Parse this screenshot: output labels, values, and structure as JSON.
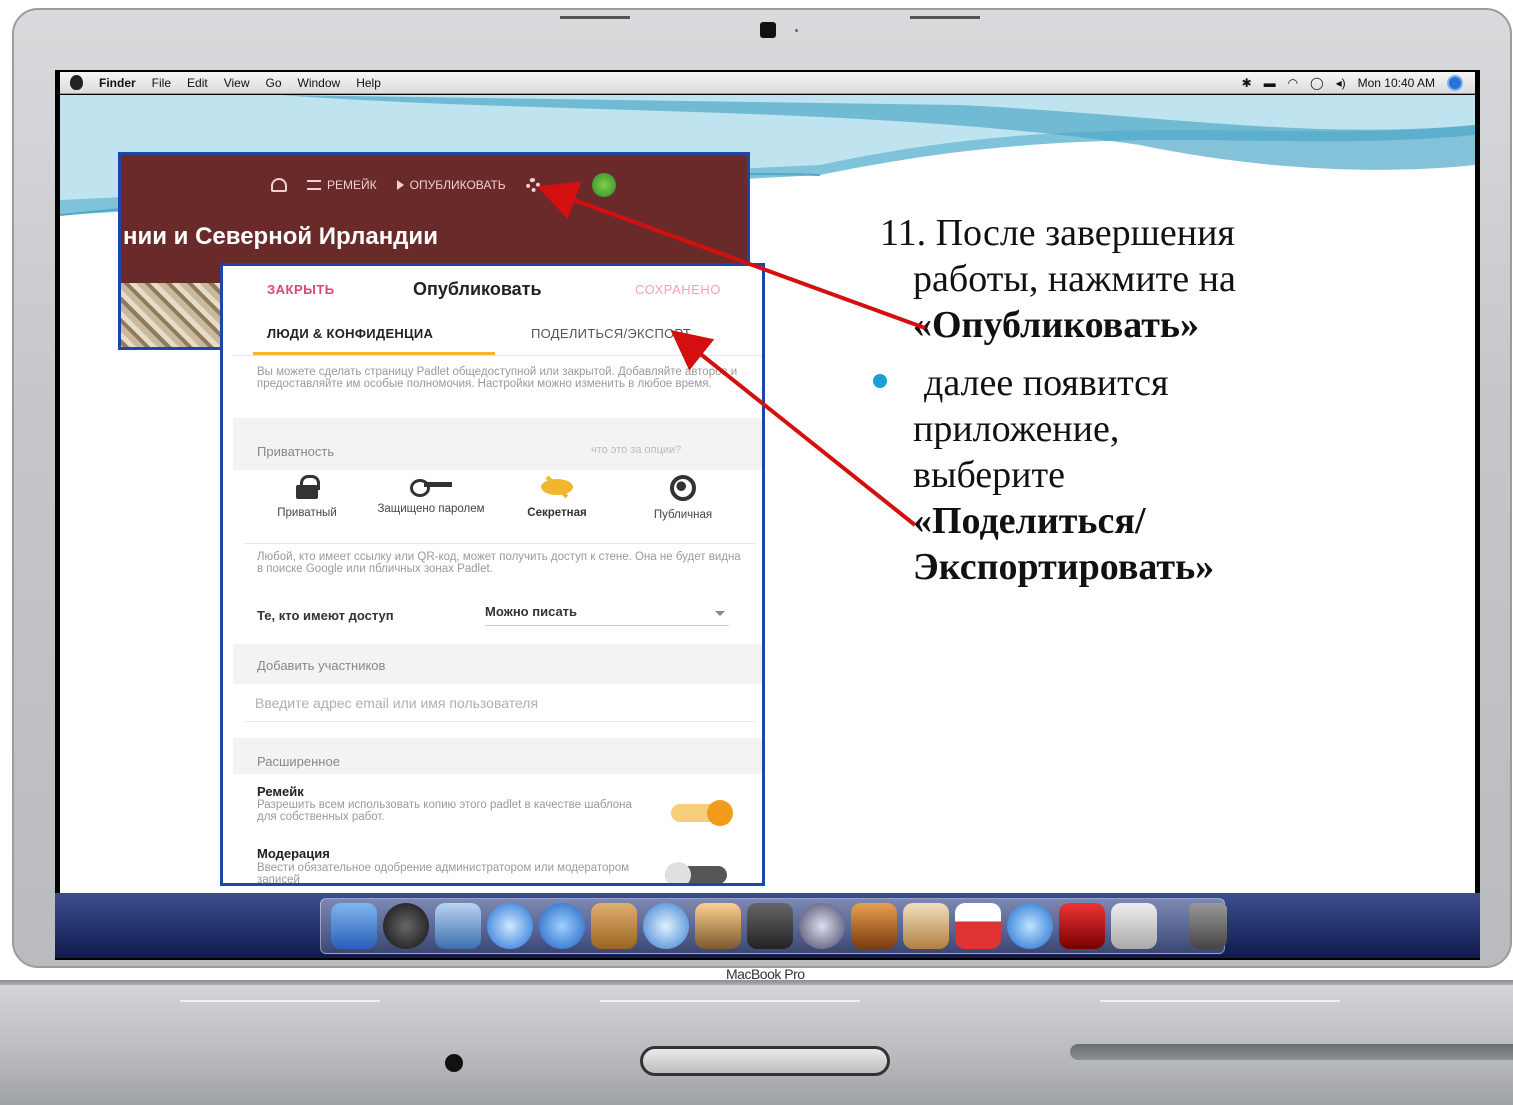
{
  "menubar": {
    "items": [
      "Finder",
      "File",
      "Edit",
      "View",
      "Go",
      "Window",
      "Help"
    ],
    "clock": "Mon 10:40 AM"
  },
  "padlet_header": {
    "remix_label": "РЕМЕЙК",
    "publish_label": "ОПУБЛИКОВАТЬ",
    "more_label": "···",
    "title": "нии и Северной Ирландии"
  },
  "dialog": {
    "close_label": "ЗАКРЫТЬ",
    "title": "Опубликовать",
    "saved_label": "СОХРАНЕНО",
    "tabs": {
      "people": "ЛЮДИ & КОНФИДЕНЦИА",
      "share": "ПОДЕЛИТЬСЯ/ЭКСПОРТ"
    },
    "description": "Вы можете сделать страницу Padlet общедоступной или закрытой. Добавляйте авторов и предоставляйте им особые полномочия. Настройки можно изменить в любое время.",
    "privacy_label": "Приватность",
    "privacy_help": "что это за опции?",
    "privacy_options": [
      {
        "label": "Приватный",
        "icon": "lock-icon"
      },
      {
        "label": "Защищено паролем",
        "icon": "key-icon"
      },
      {
        "label": "Секретная",
        "icon": "eye-off-icon"
      },
      {
        "label": "Публичная",
        "icon": "globe-icon"
      }
    ],
    "selected_privacy": "Секретная",
    "access_description": "Любой, кто имеет ссылку или QR-код, может получить доступ к стене. Она не будет видна в поиске Google или пбличных зонах Padlet.",
    "access_label": "Те, кто имеют доступ",
    "access_value": "Можно писать",
    "add_members_label": "Добавить участников",
    "email_placeholder": "Введите адрес email или имя пользователя",
    "advanced_label": "Расширенное",
    "remix": {
      "title": "Ремейк",
      "description": "Разрешить всем использовать копию этого padlet в качестве шаблона для собственных работ.",
      "enabled": true
    },
    "moderation": {
      "title": "Модерация",
      "description": "Ввести обязательное одобрение администратором или модератором записей",
      "enabled": false
    }
  },
  "slide_text": {
    "step_line1": "11. После завершения",
    "step_line2": "работы, нажмите на",
    "step_line3": "«Опубликовать»",
    "bullet_line1": "далее появится",
    "bullet_line2": "приложение,",
    "bullet_line3": "выберите",
    "bullet_line4": "«Поделиться/",
    "bullet_line5": "Экспортировать»"
  },
  "laptop_brand": "MacBook Pro",
  "colors": {
    "arrow": "#d40f0f",
    "accent_yellow": "#f2b62a",
    "close_pink": "#e0447a",
    "padlet_header": "#6a2a2a",
    "frame_blue": "#1b47a8",
    "bullet": "#1a9fd6"
  }
}
